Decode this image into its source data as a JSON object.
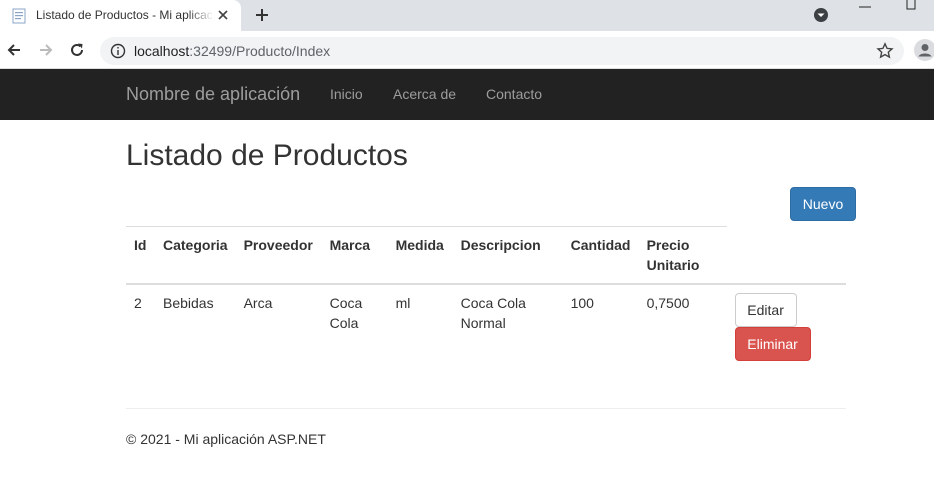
{
  "browser": {
    "tab_title": "Listado de Productos - Mi aplicación ASP.NET",
    "url_host": "localhost",
    "url_path": ":32499/Producto/Index"
  },
  "navbar": {
    "brand": "Nombre de aplicación",
    "links": [
      "Inicio",
      "Acerca de",
      "Contacto"
    ]
  },
  "page": {
    "title": "Listado de Productos",
    "new_button": "Nuevo"
  },
  "table": {
    "headers": [
      "Id",
      "Categoria",
      "Proveedor",
      "Marca",
      "Medida",
      "Descripcion",
      "Cantidad",
      "Precio Unitario"
    ],
    "rows": [
      {
        "cells": [
          "2",
          "Bebidas",
          "Arca",
          "Coca Cola",
          "ml",
          "Coca Cola Normal",
          "100",
          "0,7500"
        ],
        "edit_label": "Editar",
        "delete_label": "Eliminar"
      }
    ]
  },
  "footer": {
    "text": "© 2021 - Mi aplicación ASP.NET"
  },
  "colors": {
    "navbar_bg": "#222222",
    "primary": "#337ab7",
    "danger": "#d9534f"
  },
  "icons": [
    "document-favicon-icon",
    "close-icon",
    "plus-icon",
    "profile-menu-icon",
    "minimize-icon",
    "maximize-icon",
    "back-arrow-icon",
    "forward-arrow-icon",
    "reload-icon",
    "info-icon",
    "star-icon",
    "account-icon"
  ]
}
